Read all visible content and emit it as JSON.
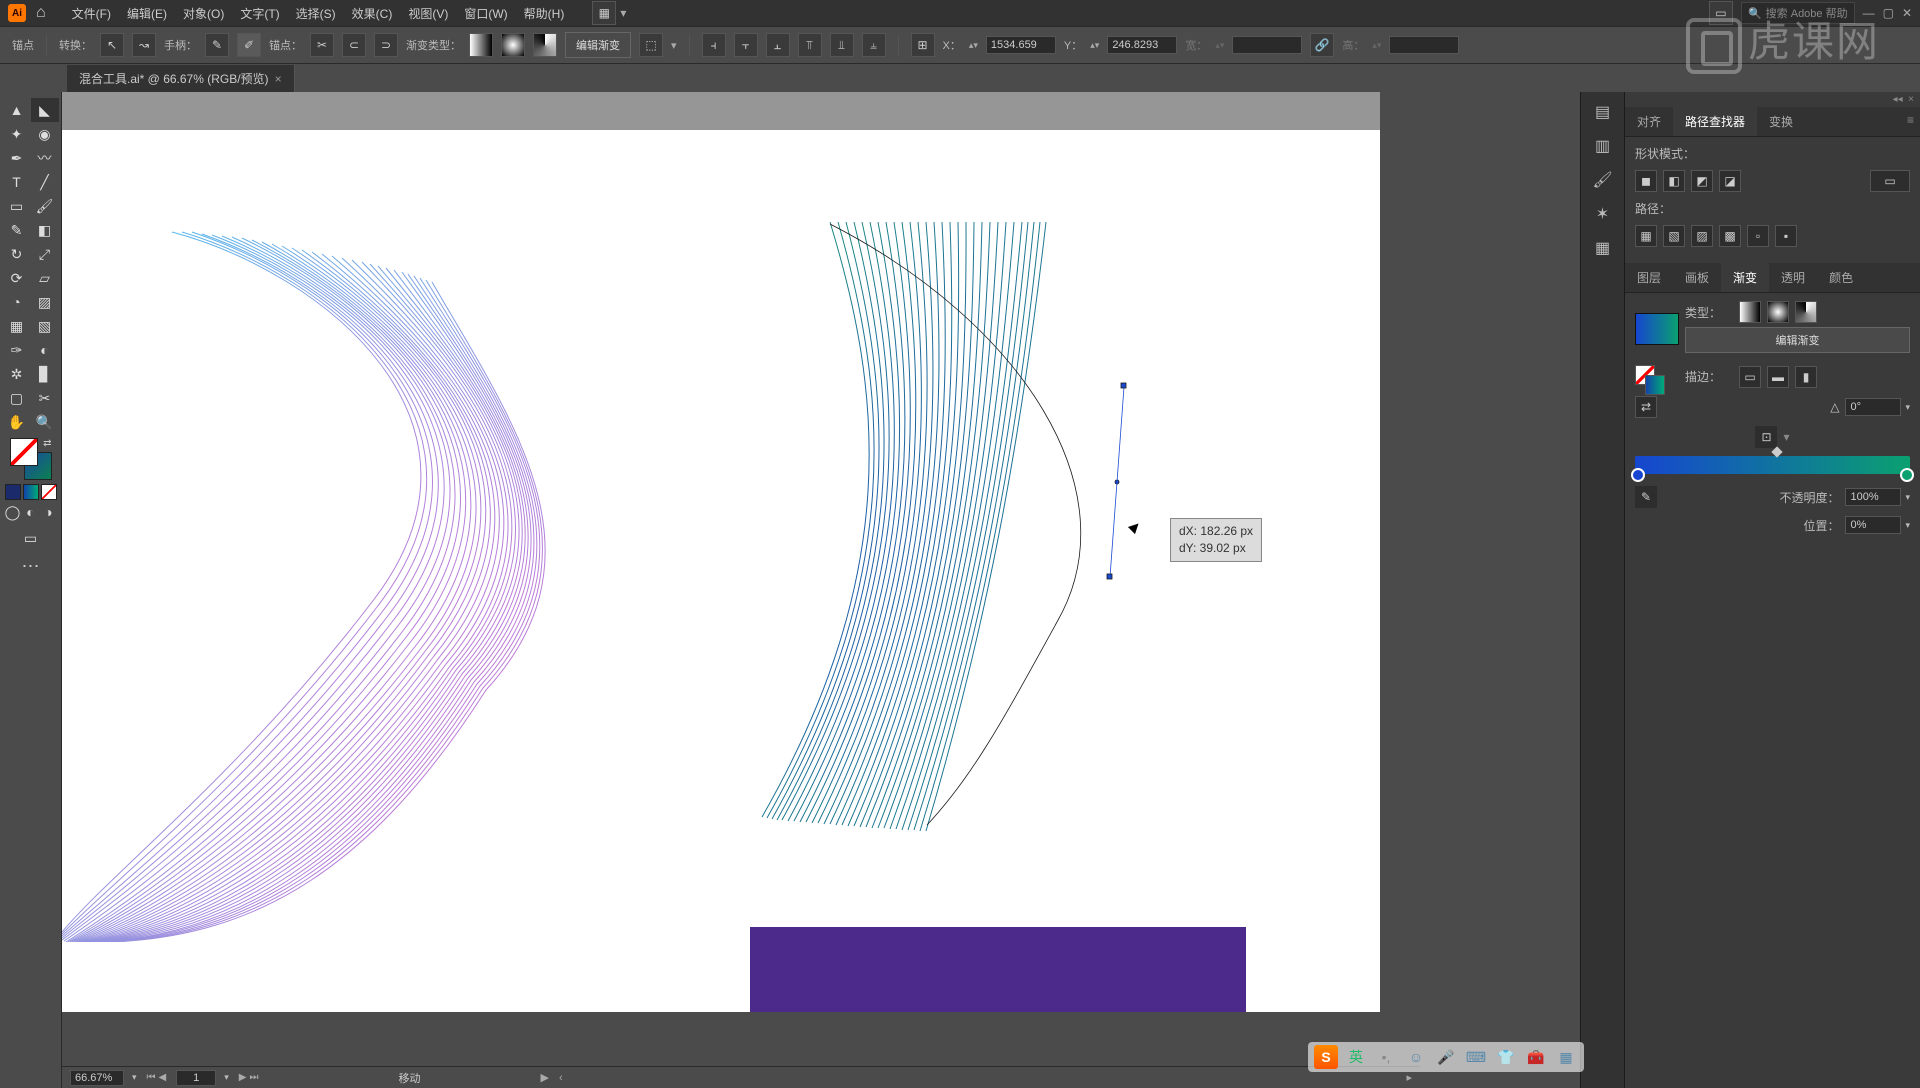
{
  "menubar": {
    "items": [
      "文件(F)",
      "编辑(E)",
      "对象(O)",
      "文字(T)",
      "选择(S)",
      "效果(C)",
      "视图(V)",
      "窗口(W)",
      "帮助(H)"
    ],
    "search_placeholder": "搜索 Adobe 帮助"
  },
  "controlbar": {
    "anchor_label": "锚点",
    "convert_label": "转换：",
    "handle_label": "手柄：",
    "anchors_label": "锚点：",
    "gradient_type_label": "渐变类型：",
    "edit_gradient": "编辑渐变",
    "x_label": "X：",
    "x_value": "1534.659",
    "y_label": "Y：",
    "y_value": "246.8293",
    "w_label": "宽：",
    "h_label": "高："
  },
  "tab": {
    "title": "混合工具.ai* @ 66.67% (RGB/预览)"
  },
  "canvas": {
    "tooltip_dx": "dX: 182.26 px",
    "tooltip_dy": "dY: 39.02 px"
  },
  "status": {
    "zoom": "66.67%",
    "page": "1",
    "mode": "移动"
  },
  "panels": {
    "top_tabs": [
      "对齐",
      "路径查找器",
      "变换"
    ],
    "shape_label": "形状模式：",
    "path_label": "路径：",
    "sub_tabs": [
      "图层",
      "画板",
      "渐变",
      "透明",
      "颜色"
    ],
    "type_label": "类型：",
    "edit_gradient": "编辑渐变",
    "stroke_label": "描边：",
    "angle_value": "0°",
    "opacity_label": "不透明度：",
    "opacity_value": "100%",
    "position_label": "位置：",
    "position_value": "0%"
  },
  "watermark_text": "虎课网",
  "ime_lang": "英"
}
